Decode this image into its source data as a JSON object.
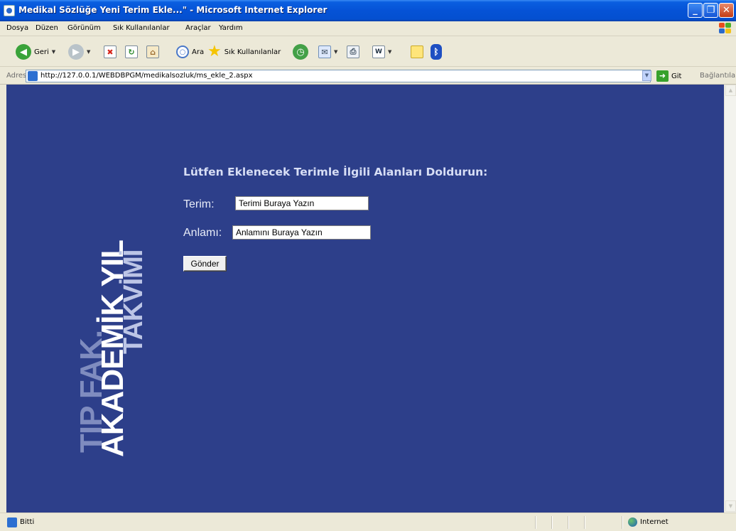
{
  "window": {
    "title": "Medikal Sözlüğe Yeni Terim Ekle...\" - Microsoft Internet Explorer",
    "minimize": "_",
    "maximize": "❐",
    "close": "✕"
  },
  "menu": [
    "Dosya",
    "Düzen",
    "Görünüm",
    "Sık Kullanılanlar",
    "Araçlar",
    "Yardım"
  ],
  "toolbar": {
    "back_label": "Geri",
    "search_label": "Ara",
    "favorites_label": "Sık Kullanılanlar"
  },
  "address": {
    "label": "Adres",
    "url": "http://127.0.0.1/WEBDBPGM/medikalsozluk/ms_ekle_2.aspx",
    "go_label": "Git",
    "links_label": "Bağlantılar"
  },
  "logo": {
    "line1": "TIP FAK.",
    "line2": "AKADEMİK YIL",
    "line3": "TAKVİMİ"
  },
  "form": {
    "title": "Lütfen Eklenecek Terimle İlgili Alanları Doldurun:",
    "term_label": "Terim:",
    "term_value": "Terimi Buraya Yazın",
    "meaning_label": "Anlamı:",
    "meaning_value": "Anlamını Buraya Yazın",
    "submit_label": "Gönder"
  },
  "status": {
    "text": "Bitti",
    "zone": "Internet"
  }
}
